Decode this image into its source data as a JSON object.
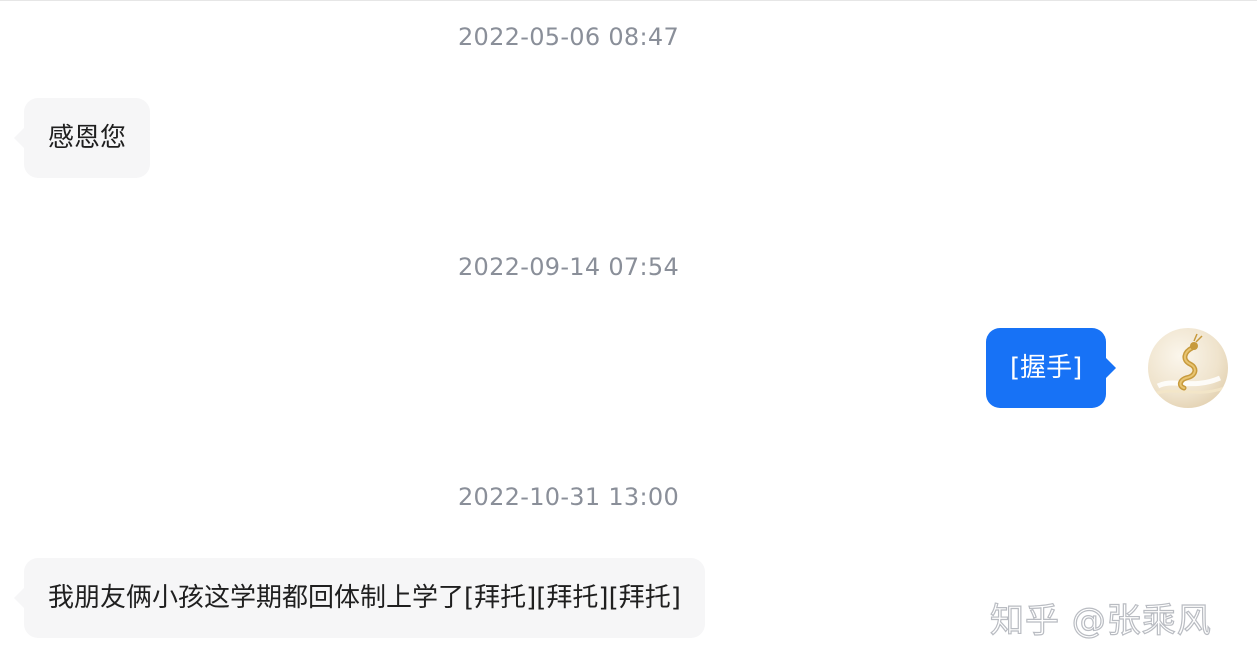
{
  "messages": [
    {
      "timestamp": "2022-05-06 08:47",
      "direction": "incoming",
      "text": "感恩您"
    },
    {
      "timestamp": "2022-09-14 07:54",
      "direction": "outgoing",
      "text": "[握手]"
    },
    {
      "timestamp": "2022-10-31 13:00",
      "direction": "incoming",
      "text": "我朋友俩小孩这学期都回体制上学了[拜托][拜托][拜托]"
    }
  ],
  "avatar": {
    "icon": "dragon-avatar-icon"
  },
  "watermark": "知乎 @张乘风",
  "colors": {
    "outgoing_bubble": "#1772f6",
    "incoming_bubble": "#f6f6f7",
    "timestamp_text": "#8a8f99"
  }
}
